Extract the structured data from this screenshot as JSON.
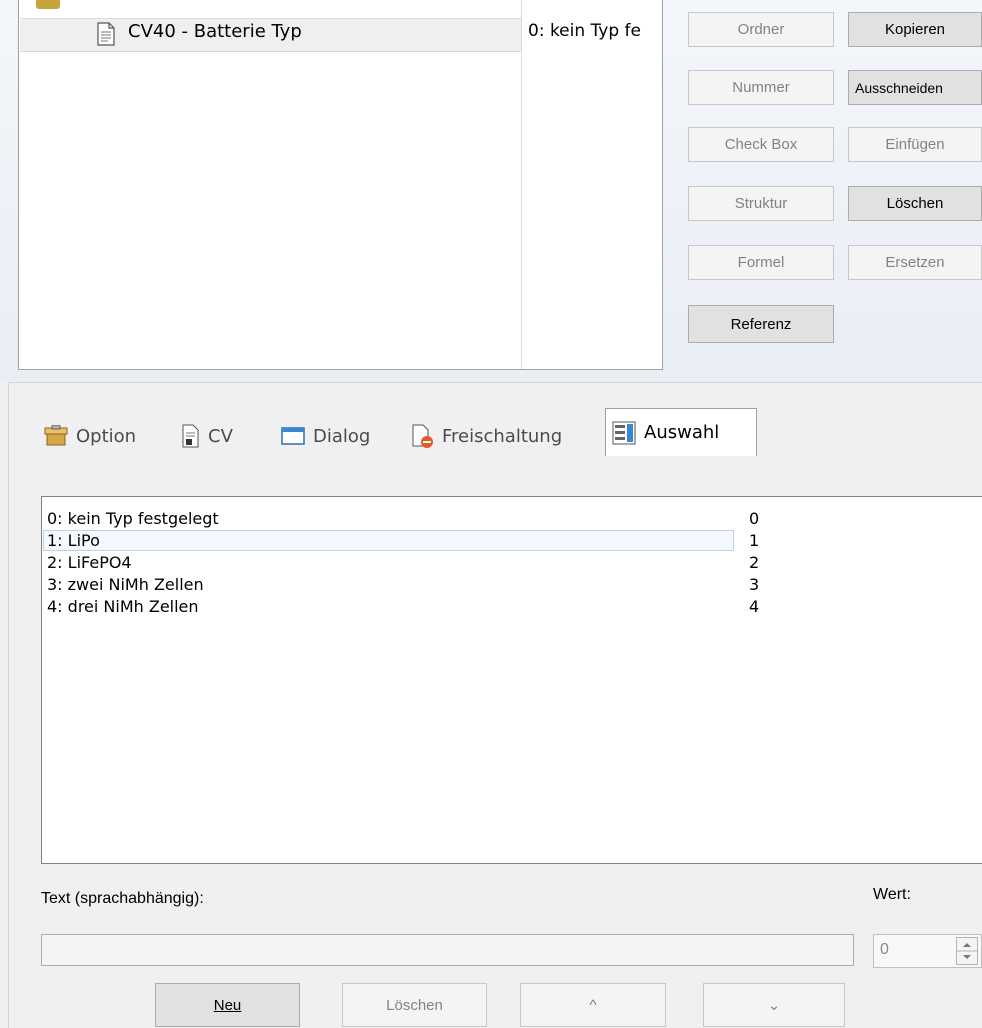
{
  "tree": {
    "selected_item": "CV40 - Batterie Typ",
    "selected_value": "0: kein Typ fe"
  },
  "buttons": {
    "ordner": "Ordner",
    "kopieren": "Kopieren",
    "nummer": "Nummer",
    "ausschneiden": "Ausschneiden",
    "checkbox": "Check Box",
    "einfuegen": "Einfügen",
    "struktur": "Struktur",
    "loeschen": "Löschen",
    "formel": "Formel",
    "ersetzen": "Ersetzen",
    "referenz": "Referenz"
  },
  "tabs": {
    "option": "Option",
    "cv": "CV",
    "dialog": "Dialog",
    "freischaltung": "Freischaltung",
    "auswahl": "Auswahl"
  },
  "list": {
    "items": [
      {
        "text": "0: kein Typ festgelegt",
        "value": "0"
      },
      {
        "text": "1: LiPo",
        "value": "1"
      },
      {
        "text": "2: LiFePO4",
        "value": "2"
      },
      {
        "text": "3: zwei NiMh Zellen",
        "value": "3"
      },
      {
        "text": "4: drei NiMh Zellen",
        "value": "4"
      }
    ]
  },
  "form": {
    "text_label": "Text (sprachabhängig):",
    "value_label": "Wert:",
    "value": "0"
  },
  "bottom_buttons": {
    "neu": "Neu",
    "loeschen": "Löschen",
    "up": "^",
    "down": "⌄"
  }
}
